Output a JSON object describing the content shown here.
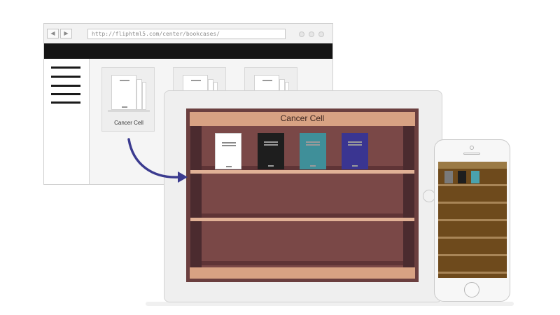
{
  "browser": {
    "url": "http://fliphtml5.com/center/bookcases/",
    "back_glyph": "◀",
    "forward_glyph": "▶",
    "shelves": [
      {
        "label": "Cancer  Cell"
      },
      {
        "label": ""
      },
      {
        "label": ""
      }
    ]
  },
  "bookcase": {
    "title": "Cancer  Cell",
    "colors": {
      "frame": "#6b3f3f",
      "trim": "#d8a283",
      "back": "#7a4847"
    },
    "books": [
      {
        "color": "#ffffff"
      },
      {
        "color": "#1e1e1e"
      },
      {
        "color": "#3f8f99"
      },
      {
        "color": "#3a3591"
      }
    ]
  },
  "phone_bookcase": {
    "books": [
      {
        "color": "#7a7a7a"
      },
      {
        "color": "#1e1e1e"
      },
      {
        "color": "#4aa2ad"
      }
    ]
  },
  "arrow": {
    "color": "#3b3b8f"
  }
}
